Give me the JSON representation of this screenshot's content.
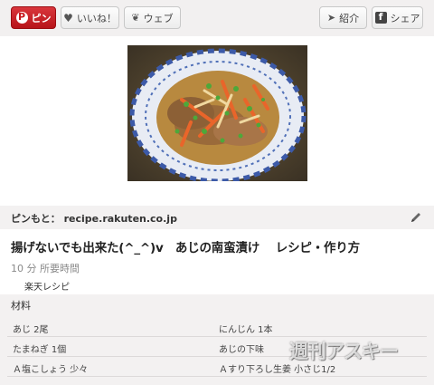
{
  "toolbar": {
    "pin_label": "ピン",
    "like_label": "いいね！",
    "web_label": "ウェブ",
    "share_intro_label": "紹介",
    "share_label": "シェア"
  },
  "source": {
    "prefix": "ピンもと：",
    "domain": "recipe.rakuten.co.jp"
  },
  "recipe": {
    "title": "揚げないでも出来た(^_^)v　あじの南蛮漬け　 レシピ・作り方",
    "time": "10 分 所要時間",
    "site": "楽天レシピ"
  },
  "ingredients": {
    "heading": "材料",
    "rows": [
      [
        "あじ 2尾",
        "にんじん 1本"
      ],
      [
        "たまねぎ 1個",
        "あじの下味"
      ],
      [
        "Ａ塩こしょう 少々",
        "Ａすり下ろし生姜 小さじ1/2"
      ]
    ]
  },
  "watermark": "週刊アスキー",
  "colors": {
    "pin_red": "#c8161d",
    "toolbar_bg": "#f2f0f0",
    "section_bg": "#f3f1f1"
  }
}
